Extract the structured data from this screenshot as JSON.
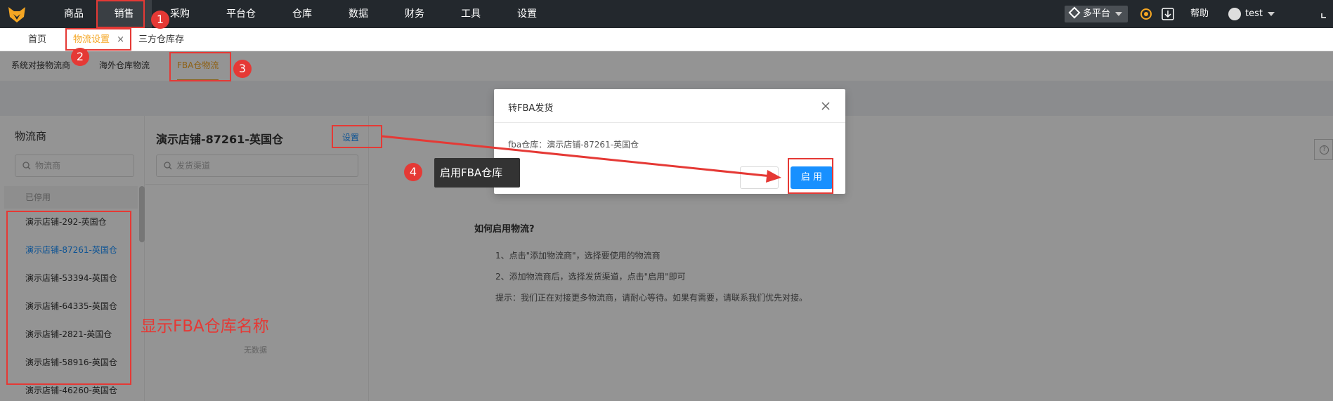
{
  "topnav": {
    "items": [
      "商品",
      "销售",
      "采购",
      "平台仓",
      "仓库",
      "数据",
      "财务",
      "工具",
      "设置"
    ],
    "platform": "多平台",
    "help": "帮助",
    "user": "test"
  },
  "pagetabs": [
    "首页",
    "物流设置",
    "三方仓库存"
  ],
  "subtabs": [
    "系统对接物流商",
    "海外仓库物流",
    "FBA仓物流"
  ],
  "left": {
    "title": "物流商",
    "search_placeholder": "物流商",
    "disabled_label": "已停用",
    "items": [
      "演示店铺-292-英国仓",
      "演示店铺-87261-英国仓",
      "演示店铺-53394-英国仓",
      "演示店铺-64335-英国仓",
      "演示店铺-2821-英国仓",
      "演示店铺-58916-英国仓",
      "演示店铺-46260-英国仓"
    ]
  },
  "middle": {
    "title": "演示店铺-87261-英国仓",
    "setting": "设置",
    "search_placeholder": "发货渠道",
    "nodata": "无数据"
  },
  "help": {
    "title": "如何启用物流?",
    "line1": "1、点击\"添加物流商\"，选择要使用的物流商",
    "line2": "2、添加物流商后，选择发货渠道，点击\"启用\"即可",
    "tip": "提示：我们正在对接更多物流商，请耐心等待。如果有需要，请联系我们优先对接。"
  },
  "modal": {
    "title": "转FBA发货",
    "body": "fba仓库：演示店铺-87261-英国仓",
    "ok": "启 用"
  },
  "annotations": {
    "badges": [
      "1",
      "2",
      "3",
      "4"
    ],
    "tooltip": "启用FBA仓库",
    "note": "显示FBA仓库名称"
  },
  "colors": {
    "accent": "#f5a623",
    "primary": "#1890ff",
    "annotation": "#e53935",
    "topbar": "#23282d"
  }
}
